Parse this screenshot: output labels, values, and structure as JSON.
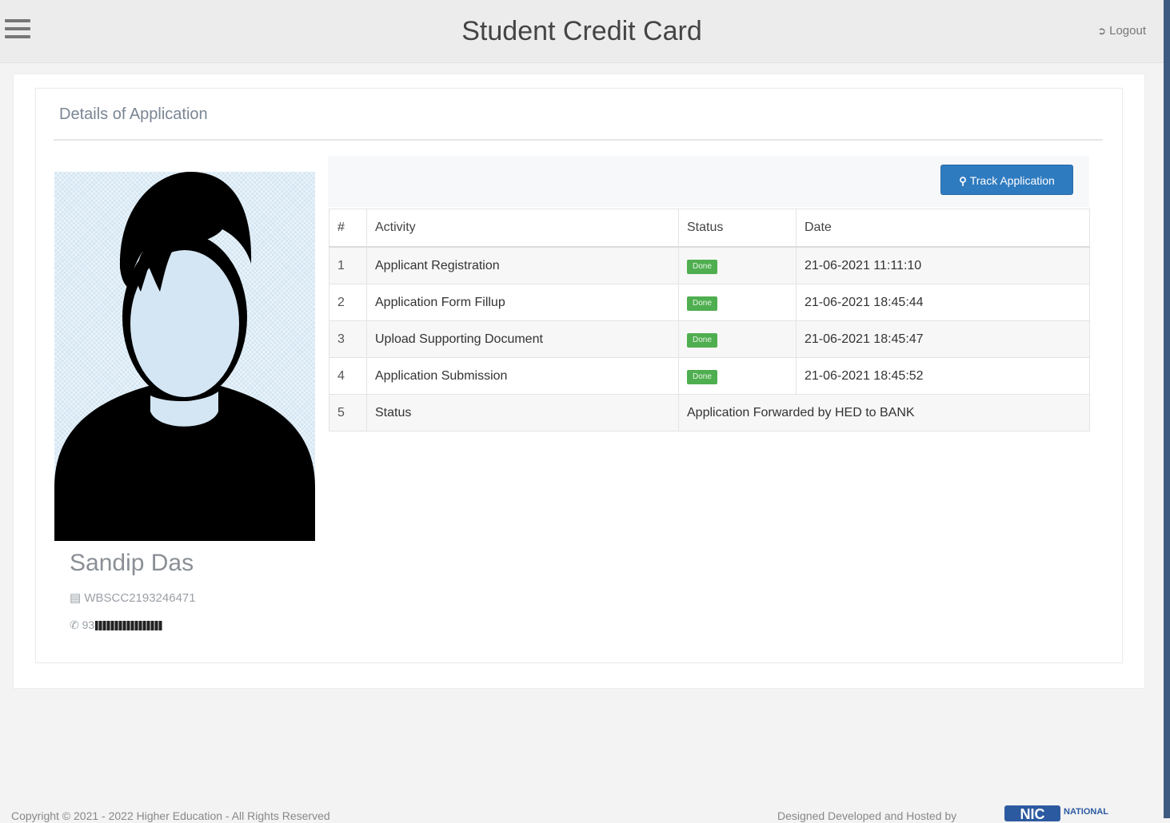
{
  "header": {
    "title": "Student Credit Card",
    "logout_label": "Logout"
  },
  "panel": {
    "heading": "Details of Application"
  },
  "student": {
    "name": "Sandip Das",
    "id": "WBSCC2193246471",
    "phone_visible_prefix": "93"
  },
  "track_button": {
    "label": "Track Application"
  },
  "table": {
    "headers": [
      "#",
      "Activity",
      "Status",
      "Date"
    ],
    "rows": [
      {
        "num": "1",
        "activity": "Applicant Registration",
        "status": "Done",
        "date": "21-06-2021 11:11:10"
      },
      {
        "num": "2",
        "activity": "Application Form Fillup",
        "status": "Done",
        "date": "21-06-2021 18:45:44"
      },
      {
        "num": "3",
        "activity": "Upload Supporting Document",
        "status": "Done",
        "date": "21-06-2021 18:45:47"
      },
      {
        "num": "4",
        "activity": "Application Submission",
        "status": "Done",
        "date": "21-06-2021 18:45:52"
      }
    ],
    "status_row": {
      "num": "5",
      "label": "Status",
      "value": "Application Forwarded by HED to BANK"
    }
  },
  "footer": {
    "copyright": "Copyright © 2021 - 2022 Higher Education - All Rights Reserved",
    "credit": "Designed Developed and Hosted by",
    "logo_text": "NIC",
    "logo_sub": "NATIONAL"
  },
  "colors": {
    "accent": "#2f7bbf",
    "done_badge": "#4fae4f",
    "edge_bar": "#3d5a80"
  },
  "icons": {
    "menu": "hamburger-icon",
    "logout": "logout-icon",
    "search": "search-icon",
    "id_card": "id-card-icon",
    "phone": "phone-icon"
  }
}
